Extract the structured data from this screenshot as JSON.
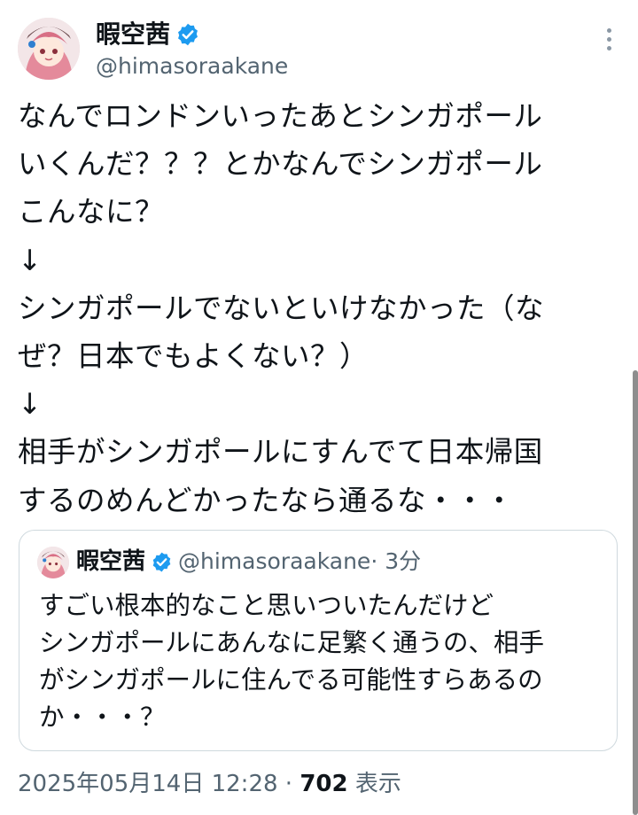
{
  "post": {
    "display_name": "暇空茜",
    "handle": "@himasoraakane",
    "body": "なんでロンドンいったあとシンガポール\nいくんだ？？？とかなんでシンガポール\nこんなに？\n↓\nシンガポールでないといけなかった（な\nぜ？日本でもよくない？）\n↓\n相手がシンガポールにすんでて日本帰国\nするのめんどかったなら通るな・・・",
    "timestamp": "2025年05月14日 12:28",
    "separator": " · ",
    "views_count": "702",
    "views_label": " 表示"
  },
  "quote": {
    "display_name": "暇空茜",
    "handle": "@himasoraakane",
    "time": " · 3分",
    "body": "すごい根本的なこと思いついたんだけど\nシンガポールにあんなに足繁く通うの、相手\nがシンガポールに住んでる可能性すらあるの\nか・・・？"
  },
  "icons": {
    "verified": "verified-badge-icon",
    "more": "more-options-icon"
  },
  "colors": {
    "verified_blue": "#1d9bf0",
    "text": "#0f1419",
    "secondary": "#536471",
    "border": "#cfd9de"
  }
}
